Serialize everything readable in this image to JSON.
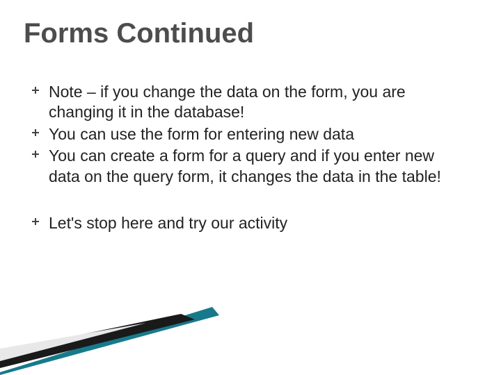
{
  "title": "Forms Continued",
  "bullets": {
    "b1": "Note – if you change the data on the form, you are changing it in the database!",
    "b2": "You can use the form for entering new data",
    "b3": "You can create a form for a query and if you enter new data on the query form, it changes the data in the table!",
    "b4": "Let's stop here and try our activity"
  }
}
